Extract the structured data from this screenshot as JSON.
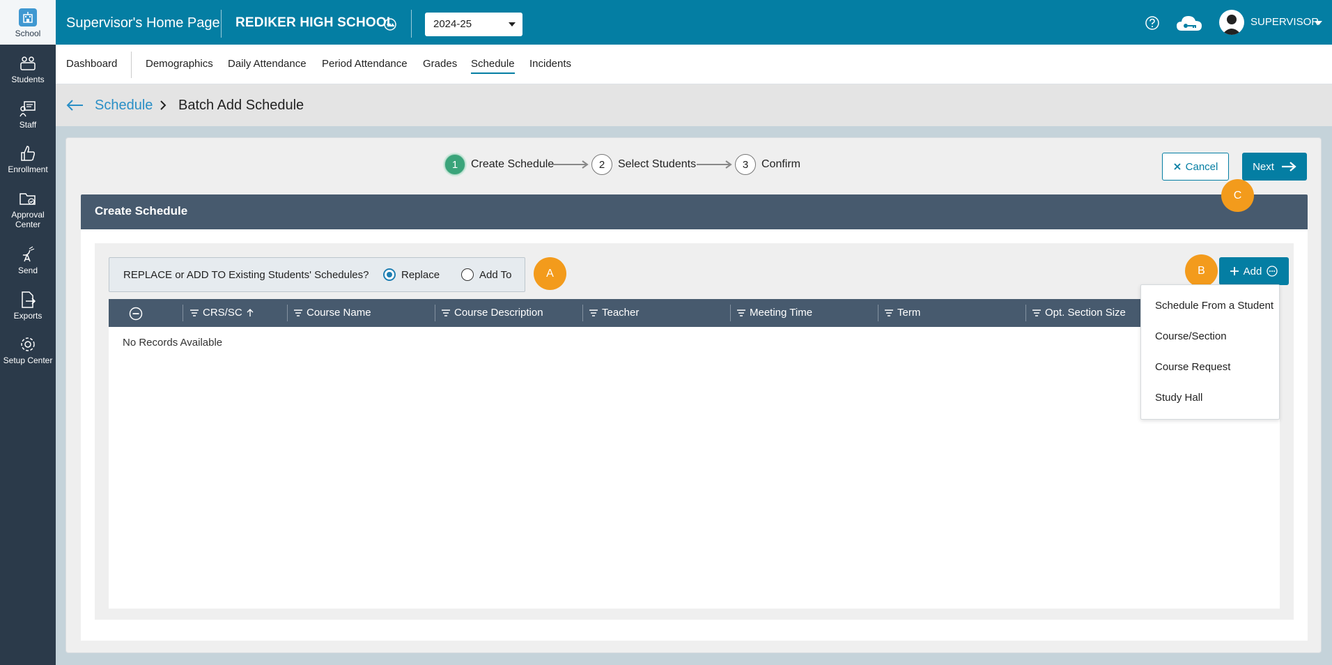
{
  "sidebar": {
    "items": [
      {
        "label": "School",
        "icon": "school-icon"
      },
      {
        "label": "Students",
        "icon": "students-icon"
      },
      {
        "label": "Staff",
        "icon": "staff-icon"
      },
      {
        "label": "Enrollment",
        "icon": "thumbs-up-icon"
      },
      {
        "label": "Approval Center",
        "icon": "folder-check-icon"
      },
      {
        "label": "Send",
        "icon": "satellite-icon"
      },
      {
        "label": "Exports",
        "icon": "export-file-icon"
      },
      {
        "label": "Setup Center",
        "icon": "gear-icon"
      }
    ]
  },
  "header": {
    "page_title": "Supervisor's Home Page",
    "school_name": "REDIKER HIGH SCHOOL",
    "school_year": "2024-25",
    "user_name": "SUPERVISOR"
  },
  "nav": {
    "tabs": [
      "Dashboard",
      "Demographics",
      "Daily Attendance",
      "Period Attendance",
      "Grades",
      "Schedule",
      "Incidents"
    ],
    "active": "Schedule"
  },
  "breadcrumb": {
    "parent": "Schedule",
    "current": "Batch Add Schedule"
  },
  "wizard": {
    "steps": [
      {
        "num": "1",
        "label": "Create Schedule"
      },
      {
        "num": "2",
        "label": "Select Students"
      },
      {
        "num": "3",
        "label": "Confirm"
      }
    ],
    "cancel_label": "Cancel",
    "next_label": "Next"
  },
  "badges": {
    "a": "A",
    "b": "B",
    "c": "C"
  },
  "section": {
    "title": "Create Schedule",
    "replace_question": "REPLACE or ADD TO Existing Students' Schedules?",
    "option_replace": "Replace",
    "option_add_to": "Add To",
    "selected_option": "Replace",
    "add_label": "Add"
  },
  "grid": {
    "columns": [
      "CRS/SC",
      "Course Name",
      "Course Description",
      "Teacher",
      "Meeting Time",
      "Term",
      "Opt. Section Size"
    ],
    "sort_column": "CRS/SC",
    "empty_message": "No Records Available"
  },
  "add_menu": {
    "items": [
      "Schedule From a Student",
      "Course/Section",
      "Course Request",
      "Study Hall"
    ]
  },
  "colors": {
    "topbar": "#047ea3",
    "sidebar": "#2b3a4a",
    "section_header": "#475a6e",
    "badge": "#f39b1c",
    "active_step": "#3aa47a"
  }
}
